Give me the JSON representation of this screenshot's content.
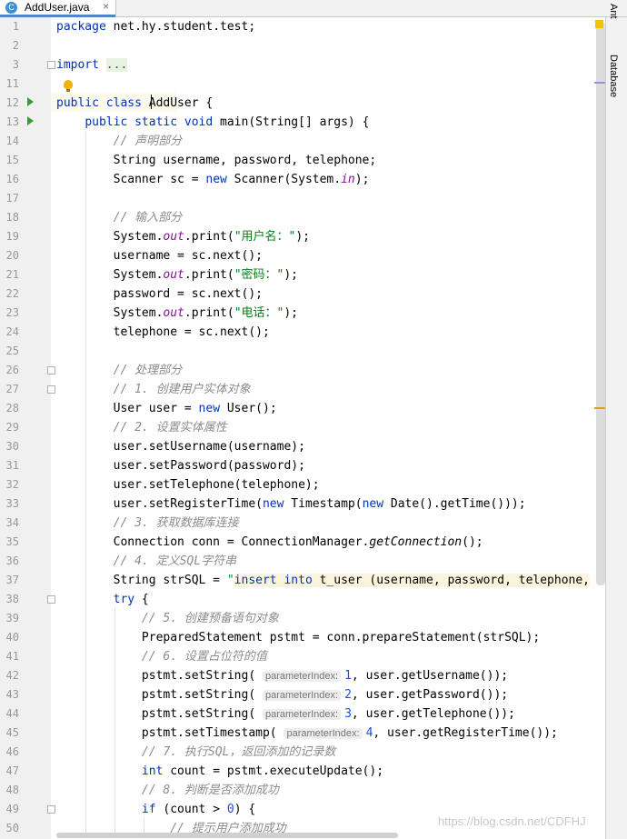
{
  "tab": {
    "icon": "java-class-icon",
    "label": "AddUser.java",
    "close": "×"
  },
  "right_tools": {
    "ant": "Ant",
    "database": "Database"
  },
  "watermark": "https://blog.csdn.net/CDFHJ",
  "lines": [
    {
      "n": "1",
      "code": "package net.hy.student.test;"
    },
    {
      "n": "2",
      "code": ""
    },
    {
      "n": "3",
      "code": "import ..."
    },
    {
      "n": "11",
      "code": ""
    },
    {
      "n": "12",
      "code": "public class AddUser {"
    },
    {
      "n": "13",
      "code": "    public static void main(String[] args) {"
    },
    {
      "n": "14",
      "code": "        // 声明部分"
    },
    {
      "n": "15",
      "code": "        String username, password, telephone;"
    },
    {
      "n": "16",
      "code": "        Scanner sc = new Scanner(System.in);"
    },
    {
      "n": "17",
      "code": ""
    },
    {
      "n": "18",
      "code": "        // 输入部分"
    },
    {
      "n": "19",
      "code": "        System.out.print(\"用户名：\");"
    },
    {
      "n": "20",
      "code": "        username = sc.next();"
    },
    {
      "n": "21",
      "code": "        System.out.print(\"密码：\");"
    },
    {
      "n": "22",
      "code": "        password = sc.next();"
    },
    {
      "n": "23",
      "code": "        System.out.print(\"电话：\");"
    },
    {
      "n": "24",
      "code": "        telephone = sc.next();"
    },
    {
      "n": "25",
      "code": ""
    },
    {
      "n": "26",
      "code": "        // 处理部分"
    },
    {
      "n": "27",
      "code": "        // 1. 创建用户实体对象"
    },
    {
      "n": "28",
      "code": "        User user = new User();"
    },
    {
      "n": "29",
      "code": "        // 2. 设置实体属性"
    },
    {
      "n": "30",
      "code": "        user.setUsername(username);"
    },
    {
      "n": "31",
      "code": "        user.setPassword(password);"
    },
    {
      "n": "32",
      "code": "        user.setTelephone(telephone);"
    },
    {
      "n": "33",
      "code": "        user.setRegisterTime(new Timestamp(new Date().getTime()));"
    },
    {
      "n": "34",
      "code": "        // 3. 获取数据库连接"
    },
    {
      "n": "35",
      "code": "        Connection conn = ConnectionManager.getConnection();"
    },
    {
      "n": "36",
      "code": "        // 4. 定义SQL字符串"
    },
    {
      "n": "37",
      "code": "        String strSQL = \"insert into t_user (username, password, telephone,"
    },
    {
      "n": "38",
      "code": "        try {"
    },
    {
      "n": "39",
      "code": "            // 5. 创建预备语句对象"
    },
    {
      "n": "40",
      "code": "            PreparedStatement pstmt = conn.prepareStatement(strSQL);"
    },
    {
      "n": "41",
      "code": "            // 6. 设置占位符的值"
    },
    {
      "n": "42",
      "code": "            pstmt.setString( parameterIndex: 1, user.getUsername());"
    },
    {
      "n": "43",
      "code": "            pstmt.setString( parameterIndex: 2, user.getPassword());"
    },
    {
      "n": "44",
      "code": "            pstmt.setString( parameterIndex: 3, user.getTelephone());"
    },
    {
      "n": "45",
      "code": "            pstmt.setTimestamp( parameterIndex: 4, user.getRegisterTime());"
    },
    {
      "n": "46",
      "code": "            // 7. 执行SQL，返回添加的记录数"
    },
    {
      "n": "47",
      "code": "            int count = pstmt.executeUpdate();"
    },
    {
      "n": "48",
      "code": "            // 8. 判断是否添加成功"
    },
    {
      "n": "49",
      "code": "            if (count > 0) {"
    },
    {
      "n": "50",
      "code": "                // 提示用户添加成功"
    }
  ]
}
